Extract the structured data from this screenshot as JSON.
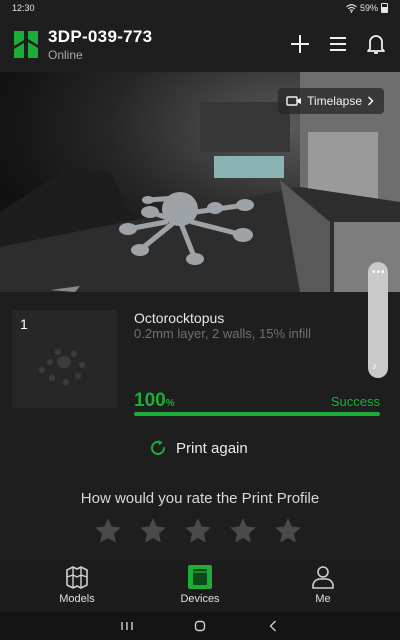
{
  "status_bar": {
    "time": "12:30",
    "battery": "59%"
  },
  "header": {
    "device_name": "3DP-039-773",
    "device_status": "Online",
    "icons": {
      "add": "plus-icon",
      "menu": "menu-icon",
      "notifications": "bell-icon"
    }
  },
  "camera": {
    "timelapse_label": "Timelapse",
    "more_label": "•••"
  },
  "print_job": {
    "plate_number": "1",
    "title": "Octorocktopus",
    "details": "0.2mm layer, 2 walls, 15% infill",
    "progress_value": "100",
    "progress_unit": "%",
    "progress_fraction": 1.0,
    "result": "Success"
  },
  "actions": {
    "print_again": "Print again"
  },
  "rating": {
    "prompt": "How would you rate the Print Profile",
    "max_stars": 5,
    "selected": 0
  },
  "tabs": [
    {
      "label": "Models",
      "icon": "models-icon"
    },
    {
      "label": "Devices",
      "icon": "devices-icon",
      "active": true
    },
    {
      "label": "Me",
      "icon": "person-icon"
    }
  ],
  "colors": {
    "accent": "#1aae38",
    "background": "#1e1e1e"
  }
}
